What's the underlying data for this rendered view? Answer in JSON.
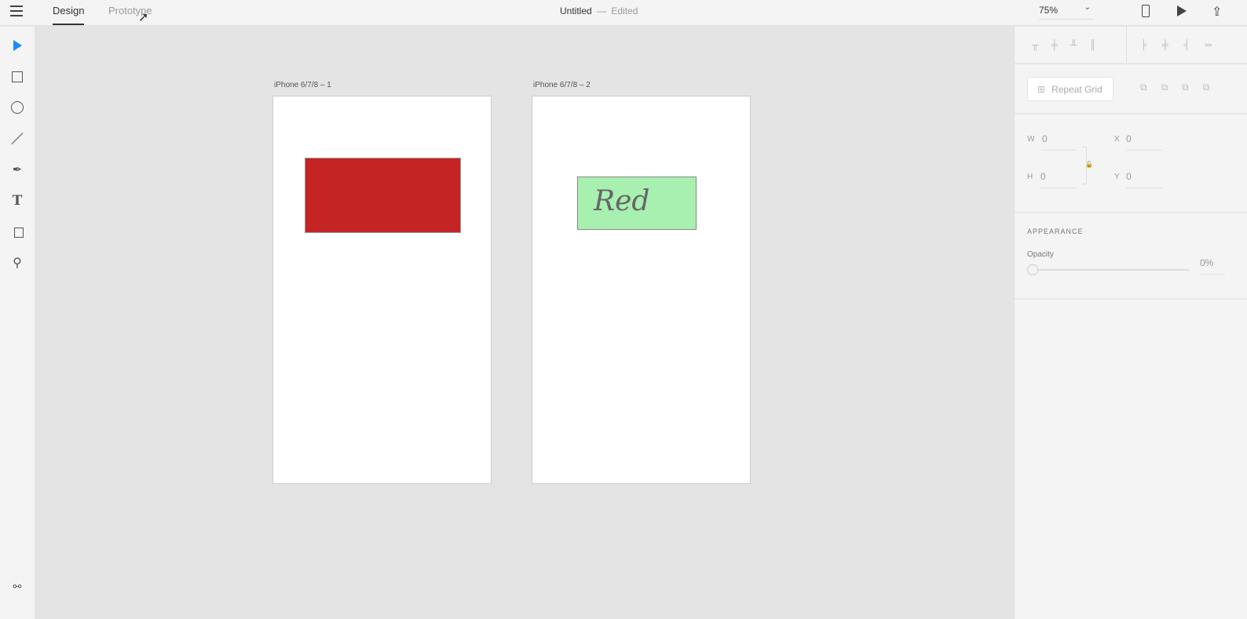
{
  "header": {
    "tabs": [
      {
        "label": "Design",
        "active": true
      },
      {
        "label": "Prototype",
        "active": false
      }
    ],
    "title": "Untitled",
    "separator": "—",
    "status": "Edited",
    "zoom": "75%"
  },
  "tools": [
    "select",
    "rectangle",
    "ellipse",
    "line",
    "pen",
    "text",
    "artboard",
    "zoom"
  ],
  "artboards": [
    {
      "label": "iPhone 6/7/8 – 1",
      "rect_color": "#c42424"
    },
    {
      "label": "iPhone 6/7/8 – 2",
      "rect_color": "#a8f0b0",
      "text": "Red"
    }
  ],
  "panel": {
    "repeat_grid": "Repeat Grid",
    "w_label": "W",
    "w": "0",
    "h_label": "H",
    "h": "0",
    "x_label": "X",
    "x": "0",
    "y_label": "Y",
    "y": "0",
    "appearance": "APPEARANCE",
    "opacity_label": "Opacity",
    "opacity": "0%"
  },
  "accent": "#1a8cff"
}
